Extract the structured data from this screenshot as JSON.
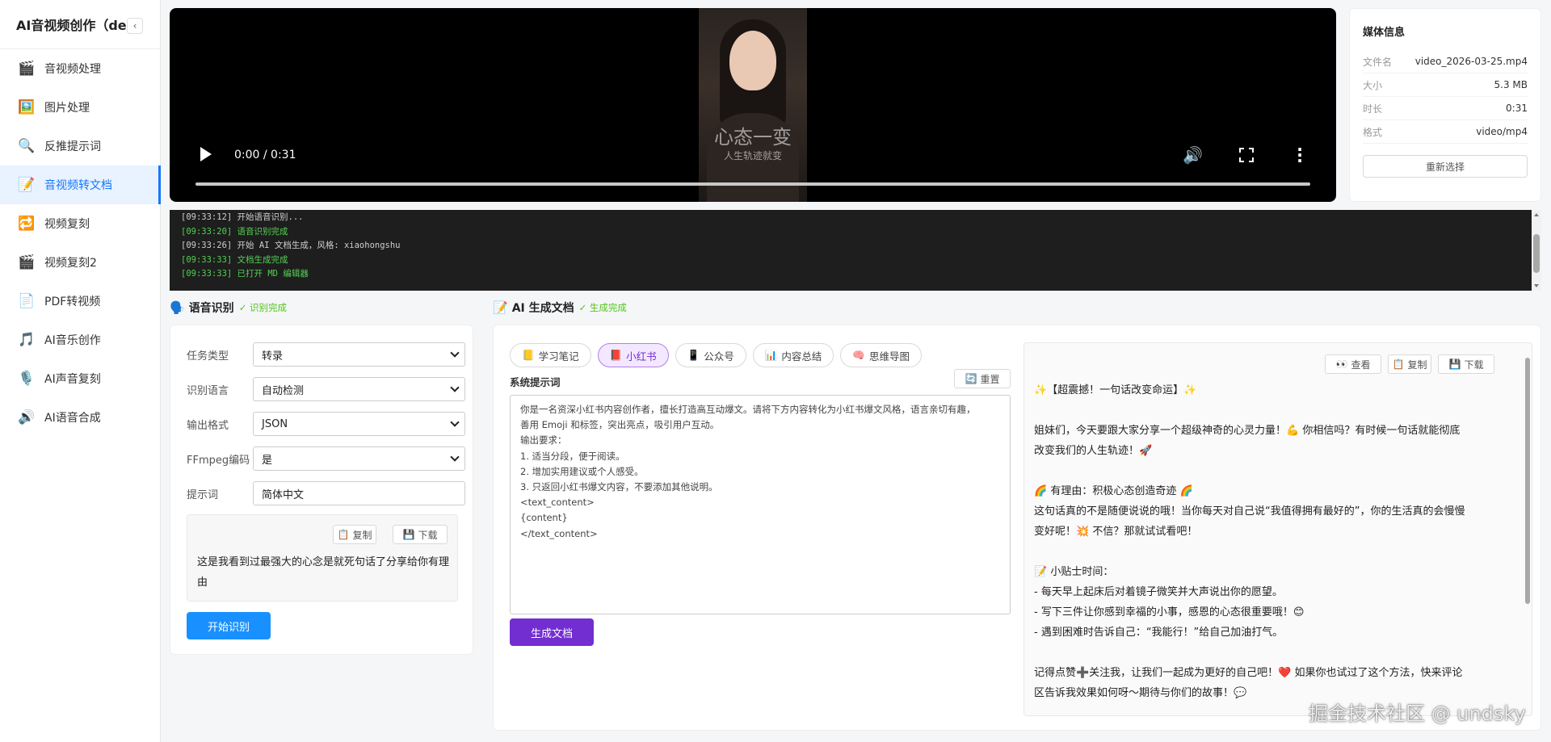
{
  "sidebar": {
    "title": "AI音视频创作（dev）",
    "collapse_glyph": "‹",
    "items": [
      {
        "label": "音视频处理",
        "icon": "🎬"
      },
      {
        "label": "图片处理",
        "icon": "🖼️"
      },
      {
        "label": "反推提示词",
        "icon": "🔍"
      },
      {
        "label": "音视频转文档",
        "icon": "📝"
      },
      {
        "label": "视频复刻",
        "icon": "🔁"
      },
      {
        "label": "视频复刻2",
        "icon": "🎬"
      },
      {
        "label": "PDF转视频",
        "icon": "📄"
      },
      {
        "label": "AI音乐创作",
        "icon": "🎵"
      },
      {
        "label": "AI声音复刻",
        "icon": "🎙️"
      },
      {
        "label": "AI语音合成",
        "icon": "🔊"
      }
    ]
  },
  "video": {
    "time": "0:00 / 0:31",
    "progress": 0,
    "thumb_title": "心态一变",
    "thumb_sub": "人生轨迹就变"
  },
  "media": {
    "title": "媒体信息",
    "rows": [
      {
        "k": "文件名",
        "v": "video_2026-03-25.mp4"
      },
      {
        "k": "大小",
        "v": "5.3 MB"
      },
      {
        "k": "时长",
        "v": "0:31"
      },
      {
        "k": "格式",
        "v": "video/mp4"
      }
    ],
    "reselect_label": "重新选择"
  },
  "log": {
    "lines": [
      {
        "text": "[09:33:12] 开始语音识别...",
        "ok": false
      },
      {
        "text": "[09:33:20] 语音识别完成",
        "ok": true
      },
      {
        "text": "[09:33:26] 开始 AI 文档生成，风格: xiaohongshu",
        "ok": false
      },
      {
        "text": "[09:33:33] 文档生成完成",
        "ok": true
      },
      {
        "text": "[09:33:33] 已打开 MD 编辑器",
        "ok": true
      }
    ]
  },
  "speech": {
    "header_icon": "🗣️",
    "title": "语音识别",
    "status": "✓ 识别完成",
    "fields": [
      {
        "label": "任务类型",
        "value": "转录"
      },
      {
        "label": "识别语言",
        "value": "自动检测"
      },
      {
        "label": "输出格式",
        "value": "JSON"
      },
      {
        "label": "FFmpeg编码",
        "value": "是"
      }
    ],
    "prompt_label": "提示词",
    "prompt_value": "简体中文",
    "copy_label": "复制",
    "download_label": "下载",
    "result_text": "这是我看到过最强大的心念是就死句话了分享给你有理由",
    "start_label": "开始识别"
  },
  "ai": {
    "header_icon": "📝",
    "title": "AI 生成文档",
    "status": "✓ 生成完成",
    "tabs": [
      {
        "label": "学习笔记",
        "icon": "📒"
      },
      {
        "label": "小红书",
        "icon": "📕"
      },
      {
        "label": "公众号",
        "icon": "📱"
      },
      {
        "label": "内容总结",
        "icon": "📊"
      },
      {
        "label": "思维导图",
        "icon": "🧠"
      }
    ],
    "system_prompt_label": "系统提示词",
    "reset_label": "重置",
    "prompt_lines": [
      "你是一名资深小红书内容创作者，擅长打造高互动爆文。请将下方内容转化为小红书爆文风格，语言亲切有趣，",
      "善用 Emoji 和标签，突出亮点，吸引用户互动。",
      "输出要求：",
      "1. 适当分段，便于阅读。",
      "2. 增加实用建议或个人感受。",
      "3. 只返回小红书爆文内容，不要添加其他说明。",
      "<text_content>",
      "{content}",
      "</text_content>"
    ],
    "generate_label": "生成文档",
    "view_label": "查看",
    "copy_label": "复制",
    "download_label": "下载",
    "preview_lines": [
      "✨【超震撼！一句话改变命运】✨",
      "",
      "姐妹们，今天要跟大家分享一个超级神奇的心灵力量！💪 你相信吗？有时候一句话就能彻底",
      "改变我们的人生轨迹！🚀",
      "",
      "🌈 有理由：积极心态创造奇迹 🌈",
      "这句话真的不是随便说说的哦！当你每天对自己说“我值得拥有最好的”，你的生活真的会慢慢",
      "变好呢！💥 不信？那就试试看吧！",
      "",
      "📝 小贴士时间：",
      "- 每天早上起床后对着镜子微笑并大声说出你的愿望。",
      "- 写下三件让你感到幸福的小事，感恩的心态很重要哦！😊",
      "- 遇到困难时告诉自己：“我能行！”给自己加油打气。",
      "",
      "记得点赞➕关注我，让我们一起成为更好的自己吧！❤️ 如果你也试过了这个方法，快来评论",
      "区告诉我效果如何呀～期待与你们的故事！💬"
    ]
  },
  "watermark": "掘金技术社区 @ undsky"
}
